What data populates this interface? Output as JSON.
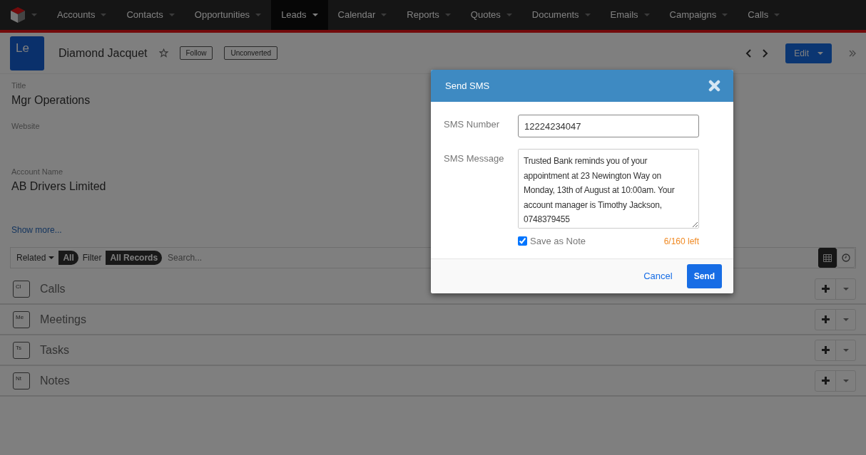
{
  "nav": {
    "items": [
      {
        "label": "Accounts",
        "selected": false
      },
      {
        "label": "Contacts",
        "selected": false
      },
      {
        "label": "Opportunities",
        "selected": false
      },
      {
        "label": "Leads",
        "selected": true
      },
      {
        "label": "Calendar",
        "selected": false
      },
      {
        "label": "Reports",
        "selected": false
      },
      {
        "label": "Quotes",
        "selected": false
      },
      {
        "label": "Documents",
        "selected": false
      },
      {
        "label": "Emails",
        "selected": false
      },
      {
        "label": "Campaigns",
        "selected": false
      },
      {
        "label": "Calls",
        "selected": false
      }
    ]
  },
  "record": {
    "avatar": "Le",
    "name": "Diamond Jacquet",
    "favorite": false,
    "follow_button": "Follow",
    "status": "Unconverted",
    "edit_button": "Edit"
  },
  "fields": [
    {
      "label": "Title",
      "value": "Mgr Operations"
    },
    {
      "label": "Website"
    },
    {
      "label": "Account Name",
      "value": "AB Drivers Limited"
    }
  ],
  "show_more": "Show more...",
  "related_bar": {
    "related": "Related",
    "related_pill": "All",
    "filter": "Filter",
    "filter_pill": "All Records",
    "search_placeholder": "Search...",
    "views": [
      {
        "kind": "grid",
        "selected": true
      },
      {
        "kind": "clock",
        "selected": false
      }
    ]
  },
  "subpanels": [
    {
      "abbr": "Cl",
      "label": "Calls"
    },
    {
      "abbr": "Me",
      "label": "Meetings"
    },
    {
      "abbr": "Ts",
      "label": "Tasks"
    },
    {
      "abbr": "Nt",
      "label": "Notes"
    }
  ],
  "modal": {
    "title": "Send SMS",
    "number_label": "SMS Number",
    "number": "12224234047",
    "message_label": "SMS Message",
    "message": "Trusted Bank reminds you of your appointment at 23 Newington Way on Monday, 13th of August at 10:00am. Your account manager is Timothy Jackson, 0748379455",
    "save_as_note": {
      "label": "Save as Note",
      "checked": true
    },
    "counter": "6/160 left",
    "cancel": "Cancel",
    "send": "Send"
  }
}
